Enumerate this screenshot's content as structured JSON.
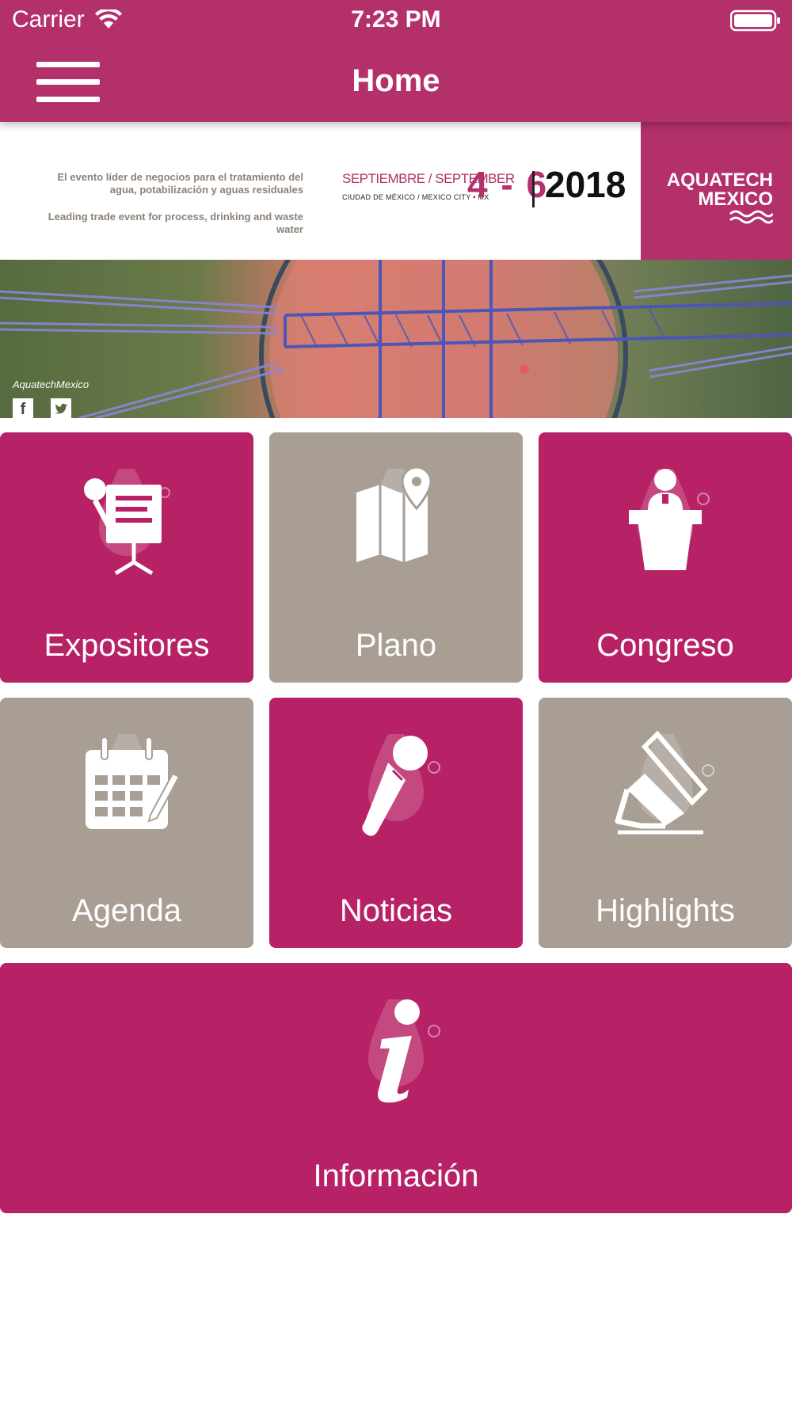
{
  "status_bar": {
    "carrier": "Carrier",
    "time": "7:23 PM"
  },
  "nav": {
    "title": "Home",
    "menu_icon": "hamburger-icon"
  },
  "banner": {
    "description_es": "El evento líder de negocios para el tratamiento del agua, potabilización y aguas residuales",
    "description_en": "Leading trade event for process, drinking and waste water",
    "month": "SEPTIEMBRE / SEPTEMBER",
    "city": "CIUDAD DE MÉXICO / MEXICO CITY • MX",
    "days": "4 - 6",
    "year": "2018",
    "brand": "AQUATECH MEXICO",
    "handle": "AquatechMexico"
  },
  "tiles": [
    {
      "label": "Expositores",
      "icon": "presentation-icon",
      "color": "#b72266"
    },
    {
      "label": "Plano",
      "icon": "map-icon",
      "color": "#a89e94"
    },
    {
      "label": "Congreso",
      "icon": "speaker-podium-icon",
      "color": "#b72266"
    },
    {
      "label": "Agenda",
      "icon": "calendar-icon",
      "color": "#a89e94"
    },
    {
      "label": "Noticias",
      "icon": "microphone-icon",
      "color": "#b72266"
    },
    {
      "label": "Highlights",
      "icon": "highlighter-icon",
      "color": "#a89e94"
    },
    {
      "label": "Información",
      "icon": "info-icon",
      "color": "#b72266"
    }
  ],
  "colors": {
    "brand": "#b3306b",
    "tile_magenta": "#b72266",
    "tile_taupe": "#a89e94"
  }
}
